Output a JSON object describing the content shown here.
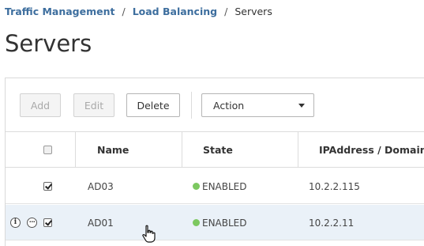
{
  "breadcrumb": {
    "items": [
      {
        "label": "Traffic Management"
      },
      {
        "label": "Load Balancing"
      },
      {
        "label": "Servers"
      }
    ],
    "separator": "/"
  },
  "page": {
    "title": "Servers"
  },
  "toolbar": {
    "add_label": "Add",
    "edit_label": "Edit",
    "delete_label": "Delete",
    "action_label": "Action"
  },
  "table": {
    "columns": [
      "Name",
      "State",
      "IPAddress / Domain"
    ],
    "rows": [
      {
        "name": "AD03",
        "state": "ENABLED",
        "ip": "10.2.2.115",
        "checked": true
      },
      {
        "name": "AD01",
        "state": "ENABLED",
        "ip": "10.2.2.11",
        "checked": true
      }
    ]
  },
  "colors": {
    "link": "#3d6e9e",
    "enabled_dot": "#7cc860",
    "row_highlight": "#eaf1f8"
  },
  "icons": {
    "info": "info-icon",
    "more": "more-options-icon",
    "cursor": "hand-cursor-icon",
    "dropdown": "chevron-down-icon"
  }
}
